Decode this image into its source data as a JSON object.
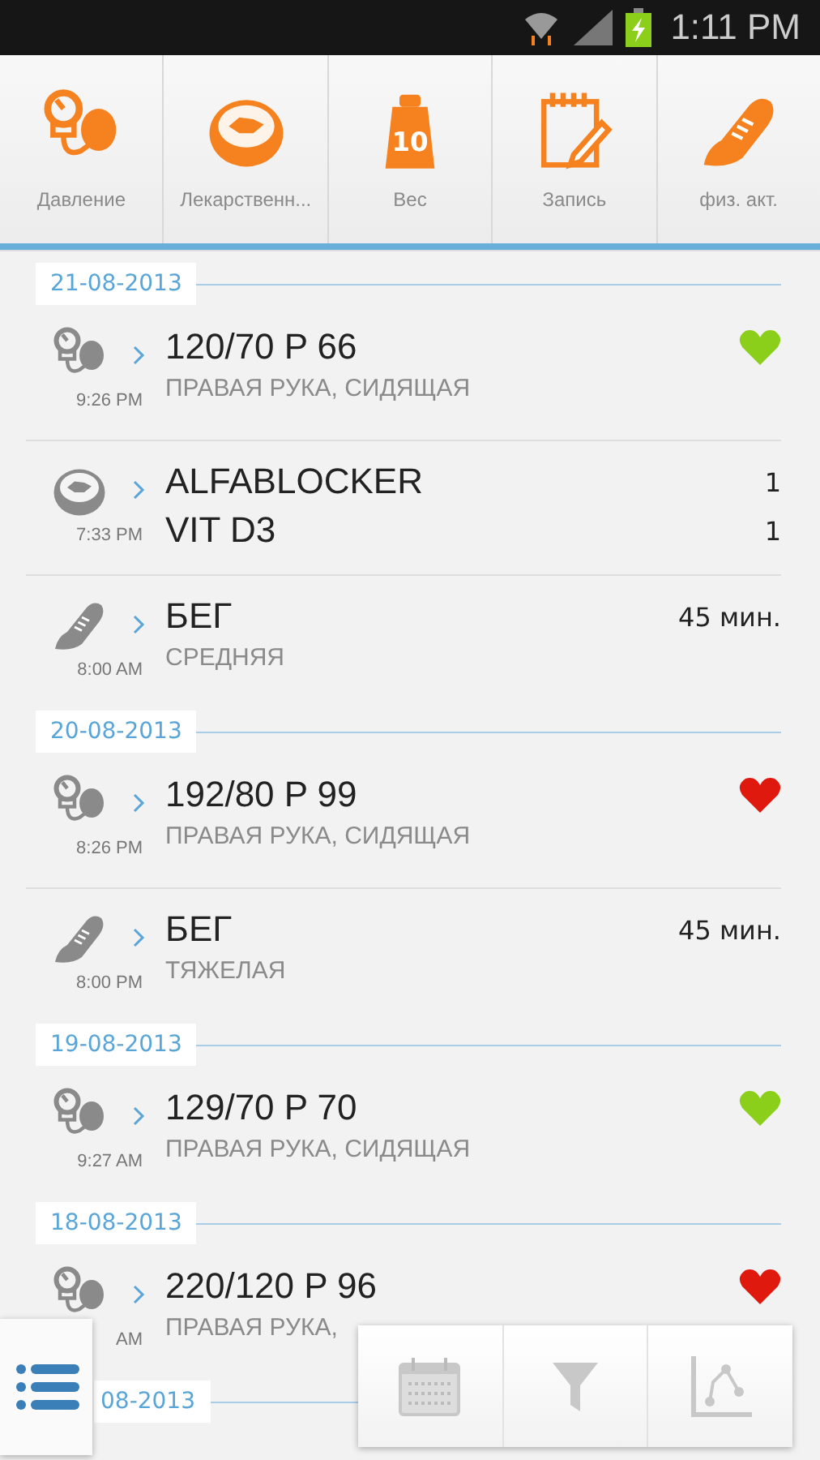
{
  "status_bar": {
    "time": "1:11 PM"
  },
  "tabs": [
    {
      "kind": "pressure",
      "label": "Давление"
    },
    {
      "kind": "pill",
      "label": "Лекарственн..."
    },
    {
      "kind": "weight",
      "label": "Вес",
      "badge": "10"
    },
    {
      "kind": "note",
      "label": "Запись"
    },
    {
      "kind": "shoe",
      "label": "физ. акт."
    }
  ],
  "days": [
    {
      "date": "21-08-2013",
      "entries": [
        {
          "kind": "pressure",
          "time": "9:26 PM",
          "title": "120/70 P 66",
          "subtitle": "ПРАВАЯ РУКА, СИДЯЩАЯ",
          "color": "#8ccf1a"
        },
        {
          "kind": "meds",
          "time": "7:33 PM",
          "items": [
            {
              "name": "ALFABLOCKER",
              "count": "1"
            },
            {
              "name": "VIT D3",
              "count": "1"
            }
          ]
        },
        {
          "kind": "activity",
          "time": "8:00 AM",
          "title": "БЕГ",
          "subtitle": "СРЕДНЯЯ",
          "duration": "45 мин."
        }
      ]
    },
    {
      "date": "20-08-2013",
      "entries": [
        {
          "kind": "pressure",
          "time": "8:26 PM",
          "title": "192/80 P 99",
          "subtitle": "ПРАВАЯ РУКА, СИДЯЩАЯ",
          "color": "#e0190f"
        },
        {
          "kind": "activity",
          "time": "8:00 PM",
          "title": "БЕГ",
          "subtitle": "ТЯЖЕЛАЯ",
          "duration": "45 мин."
        }
      ]
    },
    {
      "date": "19-08-2013",
      "entries": [
        {
          "kind": "pressure",
          "time": "9:27 AM",
          "title": "129/70 P 70",
          "subtitle": "ПРАВАЯ РУКА, СИДЯЩАЯ",
          "color": "#8ccf1a"
        }
      ]
    },
    {
      "date": "18-08-2013",
      "entries": [
        {
          "kind": "pressure",
          "time": "AM",
          "title": "220/120 P 96",
          "subtitle": "ПРАВАЯ РУКА,",
          "color": "#e0190f"
        }
      ]
    },
    {
      "date": "08-2013"
    }
  ]
}
